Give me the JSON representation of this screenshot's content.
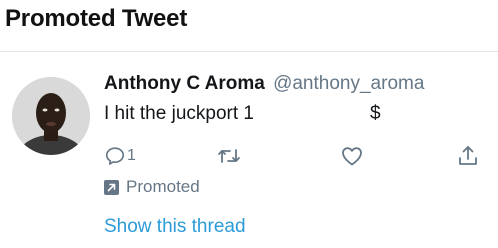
{
  "header": {
    "title": "Promoted Tweet"
  },
  "tweet": {
    "author_name": "Anthony C Aroma",
    "author_handle": "@anthony_aroma",
    "text": "I hit the juckport 1",
    "text_suffix": "$",
    "reply_count": "1",
    "promoted_label": "Promoted",
    "show_thread": "Show this thread"
  },
  "colors": {
    "link": "#2d9bd8",
    "secondary": "#657786",
    "primary_text": "#14171a"
  },
  "icons": {
    "reply": "reply-icon",
    "retweet": "retweet-icon",
    "like": "heart-icon",
    "share": "share-icon",
    "promoted": "promoted-arrow-icon"
  }
}
